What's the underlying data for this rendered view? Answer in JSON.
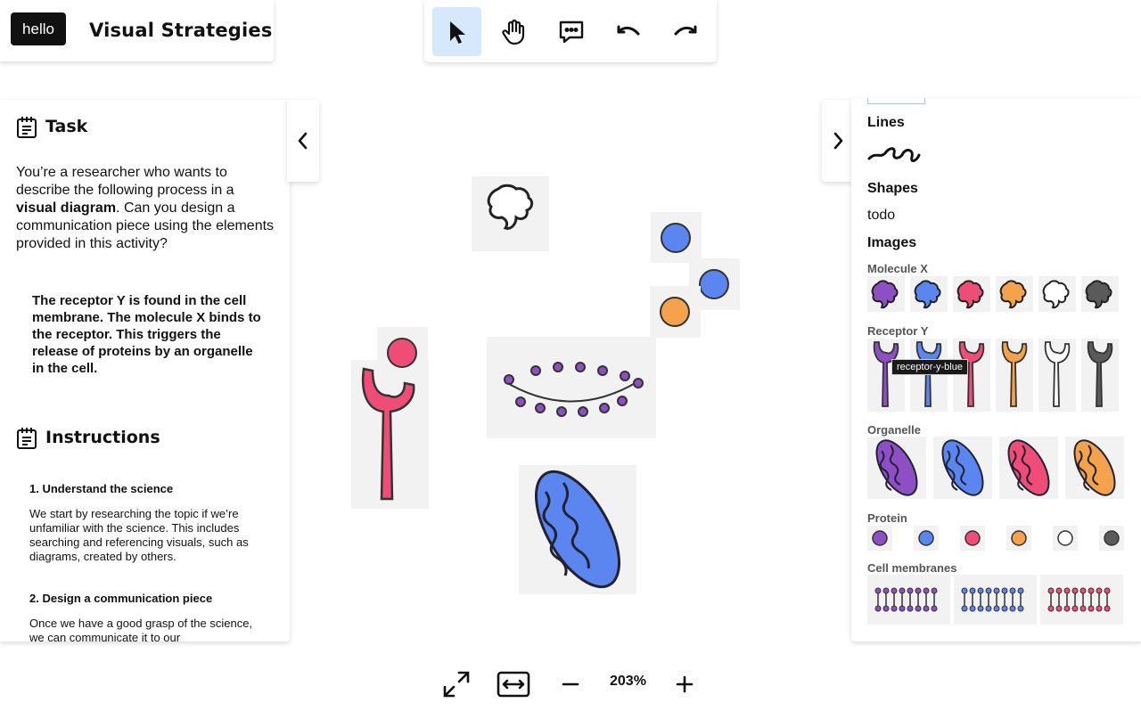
{
  "header": {
    "badge": "hello",
    "title": "Visual Strategies"
  },
  "toolbar": {
    "tools": [
      "select-tool",
      "pan-tool",
      "comment-tool",
      "undo",
      "redo"
    ],
    "active_tool": "select-tool"
  },
  "task": {
    "title": "Task",
    "body_prefix": "You’re a researcher who wants to describe the following process in a ",
    "body_bold": "visual diagram",
    "body_suffix": ". Can you design a communication piece using the elements provided in this activity?",
    "quote": "The receptor Y is found in the cell membrane. The molecule X binds to the receptor. This triggers the release of proteins by an organelle in the cell."
  },
  "instructions": {
    "title": "Instructions",
    "steps": [
      {
        "title": "1. Understand the science",
        "body": "We start by researching the topic if we’re unfamiliar with the science. This includes searching and referencing visuals, such as diagrams, created by others."
      },
      {
        "title": "2. Design a communication piece",
        "body": "Once we have a good grasp of the science, we can communicate it to our"
      }
    ]
  },
  "library": {
    "lines_label": "Lines",
    "shapes_label": "Shapes",
    "shapes_value": "todo",
    "images_label": "Images",
    "molecule_label": "Molecule X",
    "receptor_label": "Receptor Y",
    "organelle_label": "Organelle",
    "protein_label": "Protein",
    "membranes_label": "Cell membranes",
    "tooltip": "receptor-y-blue"
  },
  "colors": {
    "purple": "#8e4fc4",
    "blue": "#5b86f0",
    "pink": "#ef4d78",
    "orange": "#f4a24c",
    "white": "#ffffff",
    "gray": "#5a5a5a",
    "active": "#d6e8fb"
  },
  "zoom": {
    "level": "203%"
  }
}
